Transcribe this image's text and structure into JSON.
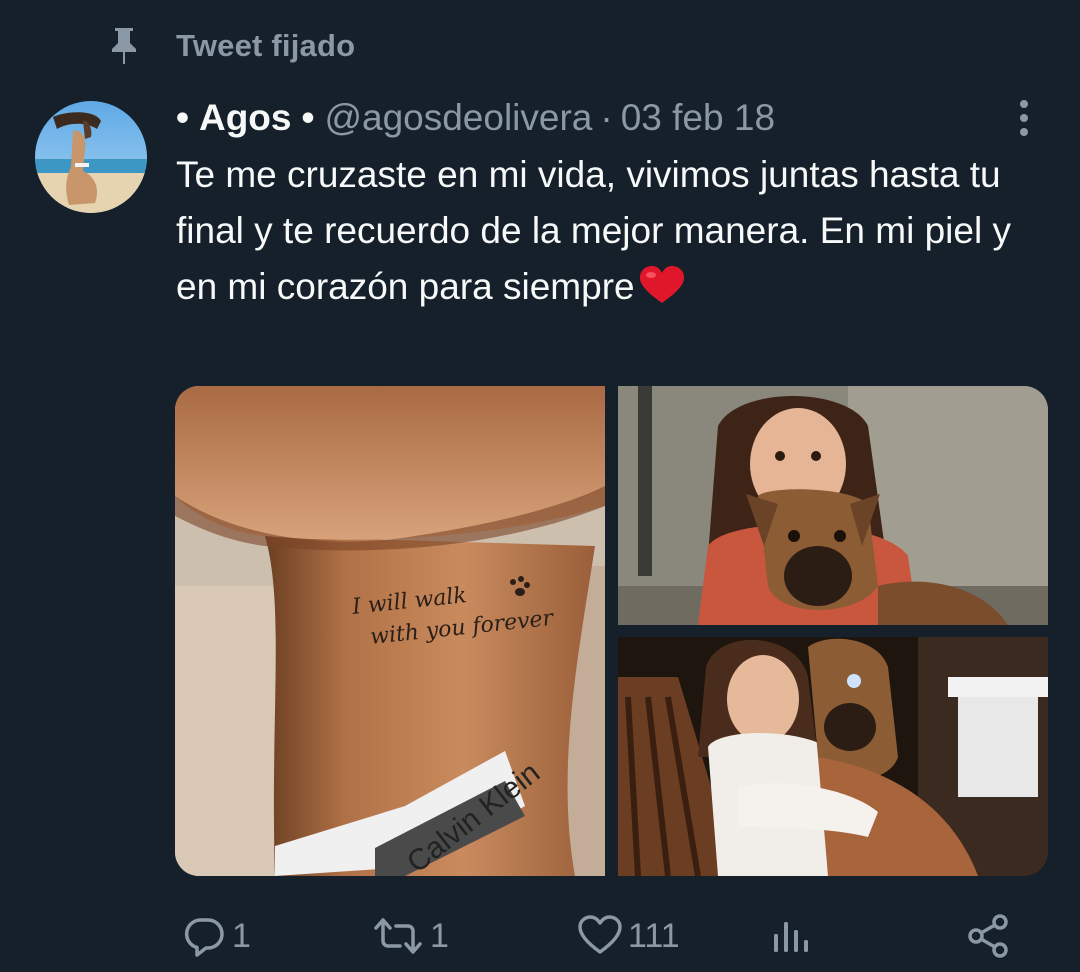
{
  "pinned": {
    "label": "Tweet fijado",
    "icon": "pin-icon"
  },
  "author": {
    "bullet_prefix": "•",
    "display_name": "Agos",
    "bullet_suffix": "•",
    "handle": "@agosdeolivera",
    "separator": "·",
    "date": "03 feb 18"
  },
  "tweet": {
    "text": "Te me cruzaste en mi vida, vivimos juntas hasta tu final y te recuerdo de la mejor manera. En mi piel y en mi corazón para siempre",
    "emoji": "red-heart-emoji"
  },
  "media": {
    "tattoo_line_1": "I will walk",
    "tattoo_line_2": "with you forever",
    "waistband_text": "Calvin Klein"
  },
  "actions": {
    "reply": {
      "icon": "reply-icon",
      "count": "1"
    },
    "retweet": {
      "icon": "retweet-icon",
      "count": "1"
    },
    "like": {
      "icon": "heart-icon",
      "count": "111"
    },
    "views": {
      "icon": "analytics-icon"
    },
    "share": {
      "icon": "share-icon"
    }
  },
  "colors": {
    "background": "#15202b",
    "primary_text": "#f7f9f9",
    "secondary_text": "#8b98a5",
    "heart_emoji": "#e0162b"
  }
}
